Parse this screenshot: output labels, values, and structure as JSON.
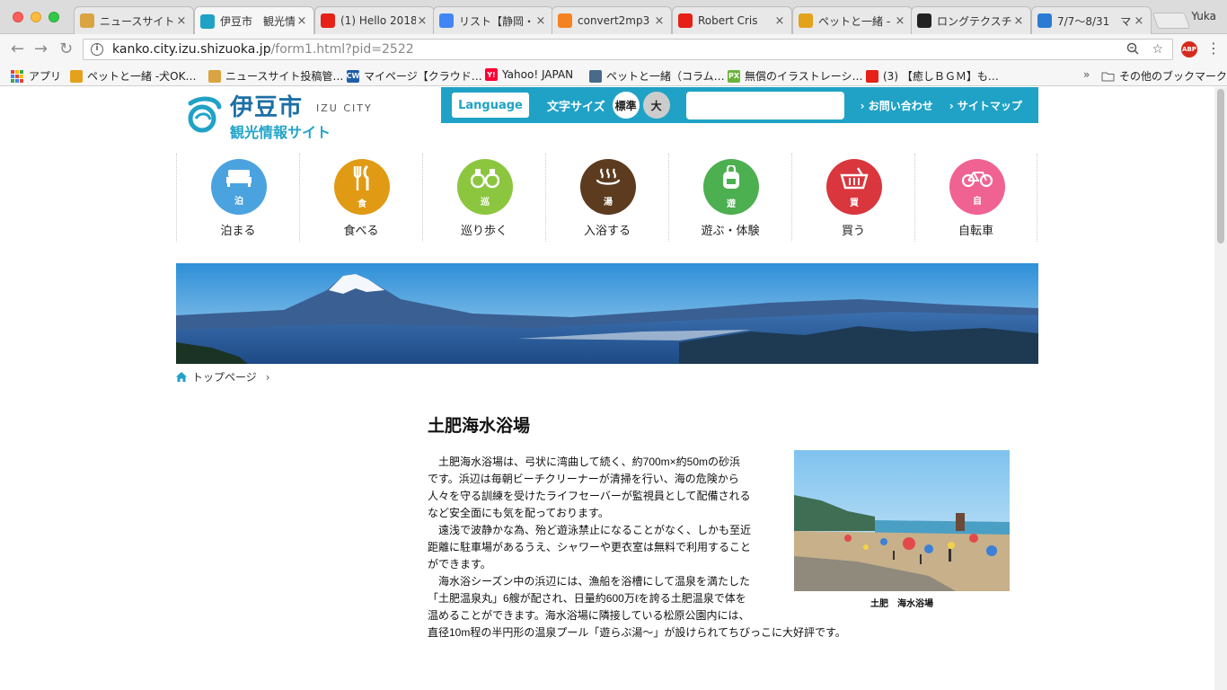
{
  "browser": {
    "tabs": [
      {
        "title": "ニュースサイト",
        "favicon": "note-icon",
        "color": "#d9a441",
        "active": false
      },
      {
        "title": "伊豆市　観光情",
        "favicon": "izu-logo-icon",
        "color": "#1fa2c6",
        "active": true
      },
      {
        "title": "(1) Hello 2018",
        "favicon": "youtube-icon",
        "color": "#e62117",
        "active": false
      },
      {
        "title": "リスト【静岡・",
        "favicon": "docs-icon",
        "color": "#4285f4",
        "active": false
      },
      {
        "title": "convert2mp3",
        "favicon": "convert-icon",
        "color": "#f58220",
        "active": false
      },
      {
        "title": "Robert Cris",
        "favicon": "youtube-icon",
        "color": "#e62117",
        "active": false
      },
      {
        "title": "ペットと一緒 - ",
        "favicon": "paw-icon",
        "color": "#e4a11b",
        "active": false
      },
      {
        "title": "ロングテクスチ",
        "favicon": "z-icon",
        "color": "#222222",
        "active": false
      },
      {
        "title": "7/7〜8/31　マ",
        "favicon": "globe-icon",
        "color": "#2b7bd3",
        "active": false
      }
    ],
    "profile_name": "Yuka",
    "url_host": "kanko.city.izu.shizuoka.jp",
    "url_path": "/form1.html?pid=2522",
    "abp_label": "ABP",
    "bookmarks": [
      {
        "label": "アプリ",
        "favicon": "apps-grid-icon"
      },
      {
        "label": "ペットと一緒 -犬OK…",
        "favicon": "paw-icon",
        "color": "#e4a11b"
      },
      {
        "label": "ニュースサイト投稿管…",
        "favicon": "note-icon",
        "color": "#d9a441"
      },
      {
        "label": "マイページ【クラウド…",
        "favicon": "cw-icon",
        "color": "#1f5ea8",
        "mark": "CW"
      },
      {
        "label": "Yahoo! JAPAN",
        "favicon": "yahoo-icon",
        "color": "#ff0033",
        "mark": "Y!"
      },
      {
        "label": "ペットと一緒（コラム…",
        "favicon": "page-icon",
        "color": "#4a6a8a"
      },
      {
        "label": "無償のイラストレーシ…",
        "favicon": "px-icon",
        "color": "#6cb33e",
        "mark": "PX"
      },
      {
        "label": "(3) 【癒しＢＧＭ】も…",
        "favicon": "youtube-icon",
        "color": "#e62117"
      }
    ],
    "bookmarks_overflow": "»",
    "other_bookmarks": "その他のブックマーク"
  },
  "site": {
    "logo": {
      "city": "伊豆市",
      "en": "IZU CITY",
      "sub": "観光情報サイト"
    },
    "utility": {
      "language_label": "Language",
      "font_size_label": "文字サイズ",
      "font_size_standard": "標準",
      "font_size_large": "大",
      "search_placeholder": "",
      "contact_label": "› お問い合わせ",
      "sitemap_label": "› サイトマップ"
    },
    "categories": [
      {
        "label": "泊まる",
        "kanji": "泊",
        "color": "#4aa3df",
        "icon": "bed-icon"
      },
      {
        "label": "食べる",
        "kanji": "食",
        "color": "#e19a14",
        "icon": "fork-knife-icon"
      },
      {
        "label": "巡り歩く",
        "kanji": "巡",
        "color": "#8cc63f",
        "icon": "binoculars-icon"
      },
      {
        "label": "入浴する",
        "kanji": "湯",
        "color": "#5c3b1e",
        "icon": "hot-spring-icon"
      },
      {
        "label": "遊ぶ・体験",
        "kanji": "遊",
        "color": "#4caf50",
        "icon": "backpack-icon"
      },
      {
        "label": "買う",
        "kanji": "買",
        "color": "#d9363e",
        "icon": "basket-icon"
      },
      {
        "label": "自転車",
        "kanji": "自",
        "color": "#f06292",
        "icon": "bicycle-icon"
      }
    ],
    "breadcrumb": {
      "home": "トップページ",
      "separator": "›"
    },
    "page_title": "土肥海水浴場",
    "article_lines": [
      "土肥海水浴場は、弓状に湾曲して続く、約700m×約50mの砂浜",
      "です。浜辺は毎朝ビーチクリーナーが清掃を行い、海の危険から",
      "人々を守る訓練を受けたライフセーバーが監視員として配備される",
      "など安全面にも気を配っております。",
      "遠浅で波静かな為、殆ど遊泳禁止になることがなく、しかも至近",
      "距離に駐車場があるうえ、シャワーや更衣室は無料で利用すること",
      "ができます。",
      "海水浴シーズン中の浜辺には、漁船を浴槽にして温泉を満たした",
      "「土肥温泉丸」6艘が配され、日量約600万ℓを誇る土肥温泉で体を",
      "温めることができます。海水浴場に隣接している松原公園内には、",
      "直径10m程の半円形の温泉プール「遊らぶ湯〜」が設けられてちびっこに大好評です。"
    ],
    "photo_caption": "土肥　海水浴場"
  }
}
